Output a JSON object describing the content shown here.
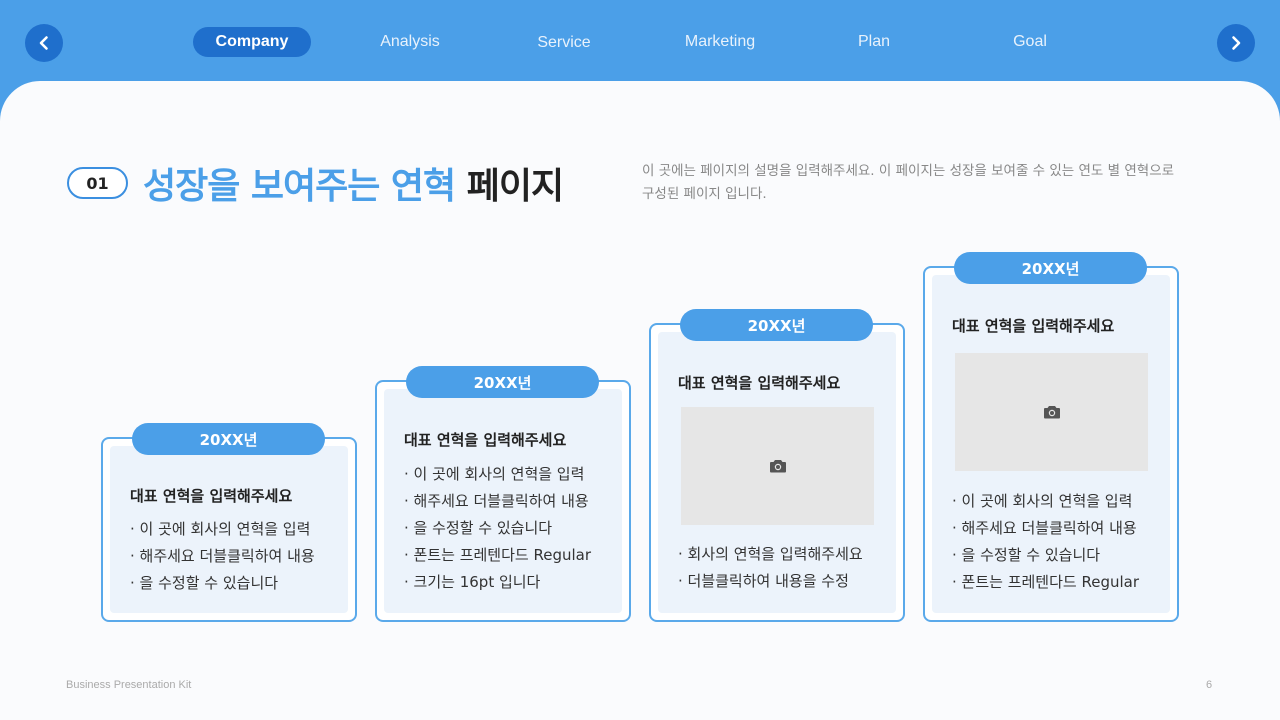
{
  "nav": {
    "prev_icon": "chevron-left-icon",
    "next_icon": "chevron-right-icon",
    "tabs": [
      {
        "label": "Company",
        "active": true
      },
      {
        "label": "Analysis",
        "active": false
      },
      {
        "label": "Service",
        "active": false
      },
      {
        "label": "Marketing",
        "active": false
      },
      {
        "label": "Plan",
        "active": false
      },
      {
        "label": "Goal",
        "active": false
      }
    ]
  },
  "header": {
    "number": "01",
    "title_highlight": "성장을 보여주는 연혁",
    "title_rest": "페이지",
    "description": "이 곳에는 페이지의 설명을 입력해주세요. 이 페이지는 성장을 보여줄 수 있는 연도 별 연혁으로 구성된 페이지 입니다."
  },
  "cards": [
    {
      "year": "20XX년",
      "heading": "대표 연혁을 입력해주세요",
      "items": [
        "· 이 곳에 회사의 연혁을 입력",
        "· 해주세요 더블클릭하여 내용",
        "· 을 수정할 수 있습니다"
      ]
    },
    {
      "year": "20XX년",
      "heading": "대표 연혁을 입력해주세요",
      "items": [
        "· 이 곳에 회사의 연혁을 입력",
        "· 해주세요 더블클릭하여 내용",
        "· 을 수정할 수 있습니다",
        "· 폰트는 프레텐다드 Regular",
        "· 크기는 16pt 입니다"
      ]
    },
    {
      "year": "20XX년",
      "heading": "대표 연혁을 입력해주세요",
      "photo_icon": "camera-icon",
      "items": [
        "· 회사의 연혁을 입력해주세요",
        "· 더블클릭하여 내용을 수정"
      ]
    },
    {
      "year": "20XX년",
      "heading": "대표 연혁을 입력해주세요",
      "photo_icon": "camera-icon",
      "items": [
        "· 이 곳에 회사의 연혁을 입력",
        "· 해주세요 더블클릭하여 내용",
        "· 을 수정할 수 있습니다",
        "· 폰트는 프레텐다드 Regular"
      ]
    }
  ],
  "footer": {
    "left": "Business Presentation Kit",
    "page": "6"
  },
  "colors": {
    "primary": "#4b9fe8",
    "active_tab": "#1f6fcc",
    "card_fill": "#ecf3fb",
    "text_dark": "#222222"
  }
}
